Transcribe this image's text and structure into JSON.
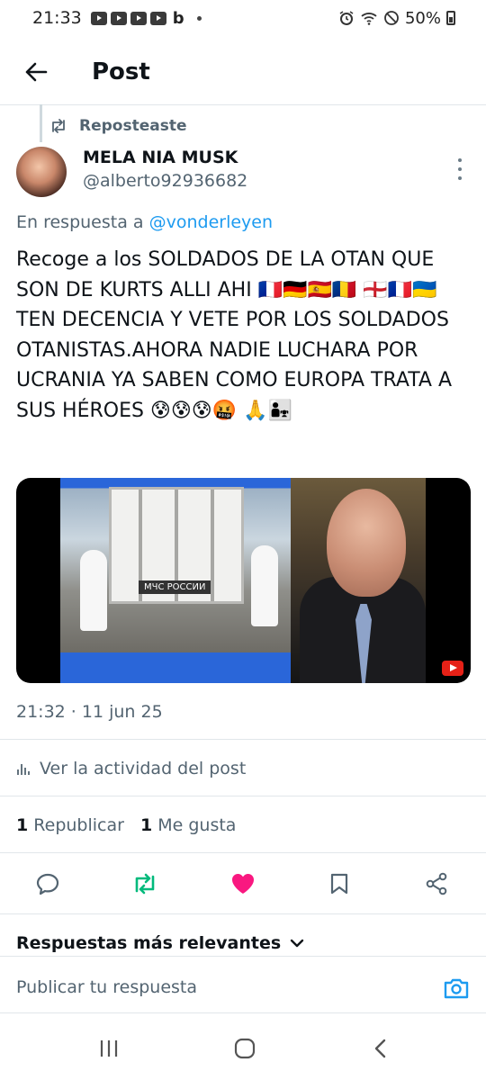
{
  "status_bar": {
    "time": "21:33",
    "notification_icons": [
      "youtube-icon",
      "youtube-icon",
      "youtube-icon",
      "youtube-icon",
      "b-icon"
    ],
    "b_glyph": "b",
    "battery": "50%"
  },
  "header": {
    "title": "Post"
  },
  "repost": {
    "label": "Reposteaste"
  },
  "author": {
    "name": "MELA NIA MUSK",
    "handle": "@alberto92936682"
  },
  "reply_to": {
    "prefix": "En respuesta a",
    "mention": "@vonderleyen"
  },
  "post": {
    "text": "Recoge a los SOLDADOS DE LA OTAN QUE SON DE KURTS ALLI AHI 🇫🇷🇩🇪🇪🇸🇷🇴 🏴󠁧󠁢󠁥󠁮󠁧󠁿🇫🇷🇺🇦 TEN DECENCIA Y VETE POR LOS SOLDADOS OTANISTAS.AHORA NADIE LUCHARA POR UCRANIA YA SABEN COMO EUROPA TRATA A SUS HÉROES 😰😰😰🤬 🙏👨‍👧",
    "media_truck_label": "МЧС РОССИИ",
    "timestamp": "21:32 · 11 jun 25"
  },
  "activity": {
    "label": "Ver la actividad del post"
  },
  "stats": {
    "reposts_count": "1",
    "reposts_label": "Republicar",
    "likes_count": "1",
    "likes_label": "Me gusta"
  },
  "colors": {
    "accent": "#1d9bf0",
    "repost_green": "#00ba7c",
    "like_pink": "#f91880",
    "muted": "#536471"
  },
  "replies": {
    "sort_label": "Respuestas más relevantes",
    "input_placeholder": "Publicar tu respuesta"
  }
}
